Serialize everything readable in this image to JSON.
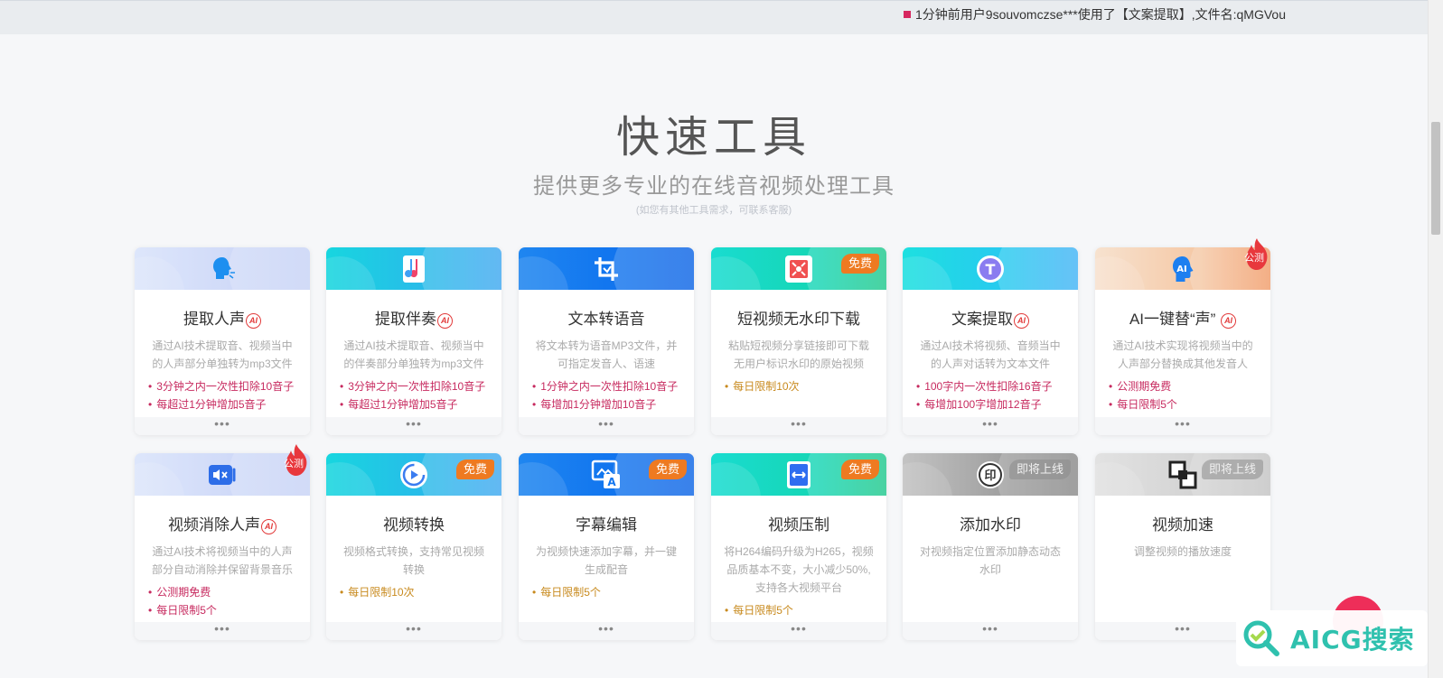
{
  "notice": {
    "text": "1分钟前用户9souvomczse***使用了【文案提取】,文件名:qMGVou"
  },
  "header": {
    "title": "快速工具",
    "subtitle": "提供更多专业的在线音视频处理工具",
    "hint": "(如您有其他工具需求，可联系客服)"
  },
  "cards": [
    {
      "title": "提取人声",
      "ai": "AI",
      "desc": "通过AI技术提取音、视频当中的人声部分单独转为mp3文件",
      "bullets": [
        "3分钟之内一次性扣除10音子",
        "每超过1分钟增加5音子"
      ],
      "more": "•••",
      "icon": "person-voice-icon"
    },
    {
      "title": "提取伴奏",
      "ai": "AI",
      "desc": "通过AI技术提取音、视频当中的伴奏部分单独转为mp3文件",
      "bullets": [
        "3分钟之内一次性扣除10音子",
        "每超过1分钟增加5音子"
      ],
      "more": "•••",
      "icon": "music-note-icon"
    },
    {
      "title": "文本转语音",
      "desc": "将文本转为语音MP3文件，并可指定发音人、语速",
      "bullets": [
        "1分钟之内一次性扣除10音子",
        "每增加1分钟增加10音子"
      ],
      "more": "•••",
      "icon": "crop-icon"
    },
    {
      "title": "短视频无水印下载",
      "tag": "免费",
      "desc": "粘贴短视频分享链接即可下载无用户标识水印的原始视频",
      "bullets": [
        "每日限制10次"
      ],
      "more": "•••",
      "icon": "video-download-icon"
    },
    {
      "title": "文案提取",
      "ai": "AI",
      "desc": "通过AI技术将视频、音频当中的人声对话转为文本文件",
      "bullets": [
        "100字内一次性扣除16音子",
        "每增加100字增加12音子"
      ],
      "more": "•••",
      "icon": "text-t-icon"
    },
    {
      "title": "AI一键替“声”",
      "ai": "AI",
      "flame": "公测",
      "desc": "通过AI技术实现将视频当中的人声部分替换成其他发音人",
      "bullets": [
        "公测期免费",
        "每日限制5个"
      ],
      "more": "•••",
      "icon": "ai-voice-icon"
    },
    {
      "title": "视频消除人声",
      "ai": "AI",
      "flame": "公测",
      "desc": "通过AI技术将视频当中的人声部分自动消除并保留背景音乐",
      "bullets": [
        "公测期免费",
        "每日限制5个"
      ],
      "more": "•••",
      "icon": "mute-video-icon"
    },
    {
      "title": "视频转换",
      "tag": "免费",
      "desc": "视频格式转换，支持常见视频转换",
      "bullets": [
        "每日限制10次"
      ],
      "more": "•••",
      "icon": "convert-icon"
    },
    {
      "title": "字幕编辑",
      "tag": "免费",
      "desc": "为视频快速添加字幕，并一键生成配音",
      "bullets": [
        "每日限制5个"
      ],
      "more": "•••",
      "icon": "subtitle-icon"
    },
    {
      "title": "视频压制",
      "tag": "免费",
      "desc": "将H264编码升级为H265，视频品质基本不变，大小减少50%,支持各大视频平台",
      "bullets": [
        "每日限制5个"
      ],
      "more": "•••",
      "icon": "compress-icon"
    },
    {
      "title": "添加水印",
      "tag": "即将上线",
      "desc": "对视频指定位置添加静态动态水印",
      "bullets": [],
      "more": "•••",
      "icon": "watermark-icon"
    },
    {
      "title": "视频加速",
      "tag": "即将上线",
      "desc": "调整视频的播放速度",
      "bullets": [],
      "more": "•••",
      "icon": "speed-icon"
    }
  ],
  "watermark": {
    "text": "AICG搜索"
  }
}
